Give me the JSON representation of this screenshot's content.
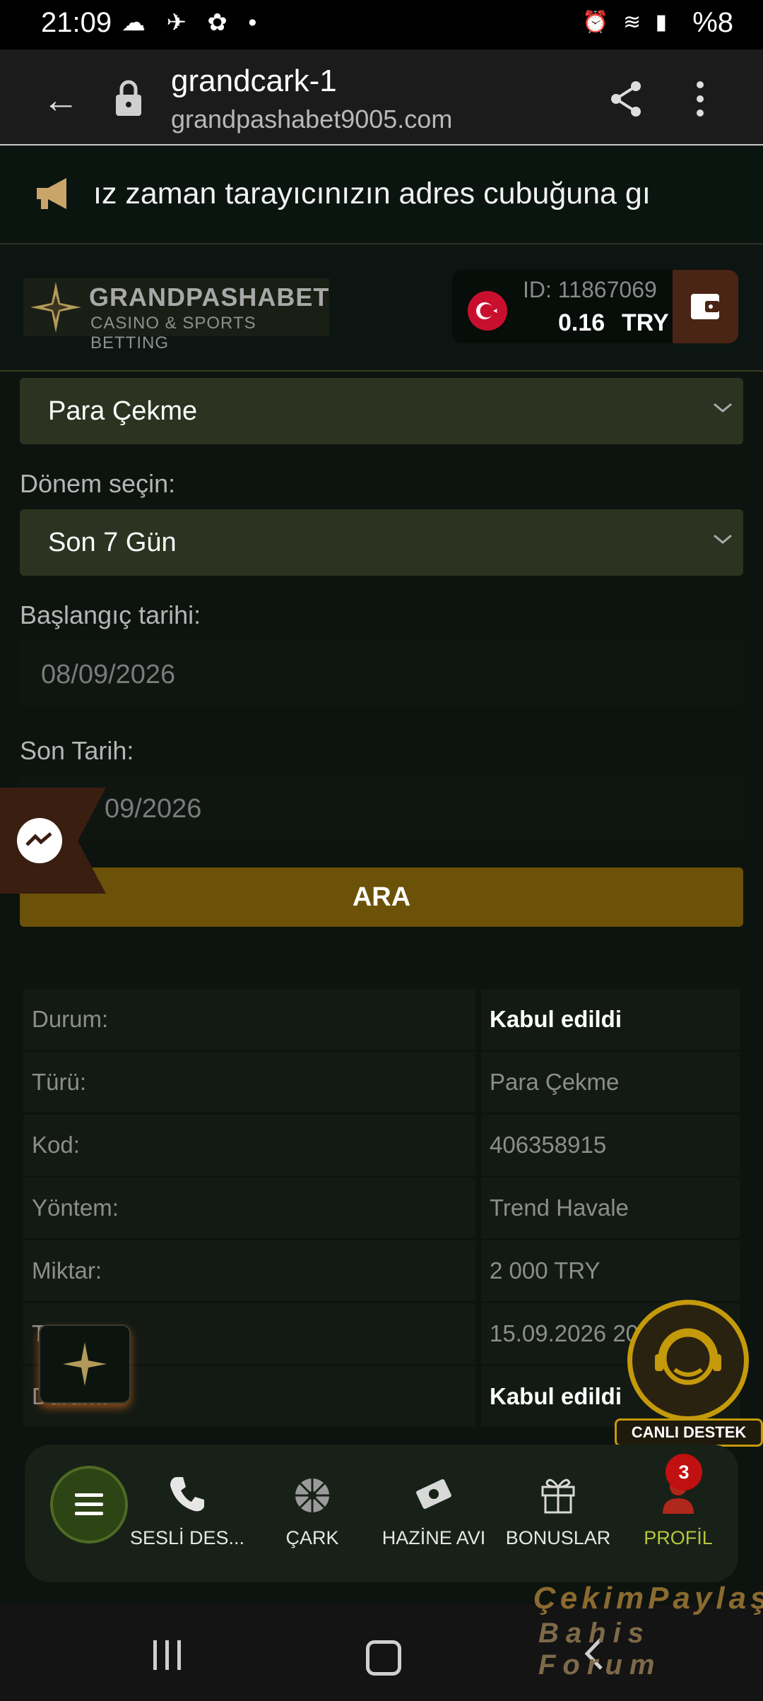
{
  "status_bar": {
    "time": "21:09",
    "battery": "%8",
    "icons": [
      "cloud-icon",
      "telegram-icon",
      "flower-icon",
      "dot-icon",
      "alarm-icon",
      "wifi-icon",
      "volte-icon",
      "signal-icon",
      "battery-icon"
    ]
  },
  "browser": {
    "page_title": "grandcark-1",
    "url": "grandpashabet9005.com"
  },
  "announcement": {
    "text": "ız zaman tarayıcınızın adres cubuğuna gı"
  },
  "header": {
    "logo_name": "GRANDPASHABET",
    "logo_tagline": "CASINO & SPORTS BETTING",
    "account_id": "ID: 11867069",
    "balance": "0.16",
    "currency": "TRY"
  },
  "filters": {
    "type_select": "Para Çekme",
    "period_label": "Dönem seçin:",
    "period_select": "Son 7 Gün",
    "start_label": "Başlangıç tarihi:",
    "start_value": "08/09/2026",
    "end_label": "Son Tarih:",
    "end_value": "09/2026",
    "search_label": "ARA"
  },
  "transactions": [
    {
      "key": "Durum:",
      "value": "Kabul edildi",
      "bold": true
    },
    {
      "key": "Türü:",
      "value": "Para Çekme"
    },
    {
      "key": "Kod:",
      "value": "406358915"
    },
    {
      "key": "Yöntem:",
      "value": "Trend Havale"
    },
    {
      "key": "Miktar:",
      "value": "2 000 TRY"
    },
    {
      "key": "T",
      "value": "15.09.2026 20"
    },
    {
      "key": "Durum:",
      "value": "Kabul edildi",
      "bold": true
    }
  ],
  "floating": {
    "live_support": "CANLI DESTEK"
  },
  "bottom_nav": {
    "items": [
      {
        "label": "SESLİ DES...",
        "icon": "phone-icon"
      },
      {
        "label": "ÇARK",
        "icon": "wheel-icon"
      },
      {
        "label": "HAZİNE AVI",
        "icon": "treasure-icon"
      },
      {
        "label": "BONUSLAR",
        "icon": "gift-icon"
      },
      {
        "label": "PROFİL",
        "icon": "user-icon"
      }
    ],
    "profile_badge": "3",
    "active_color": "#b8c43b"
  },
  "watermark": {
    "line1": "ÇekimPaylaş",
    "line2": "Bahis Forum"
  }
}
